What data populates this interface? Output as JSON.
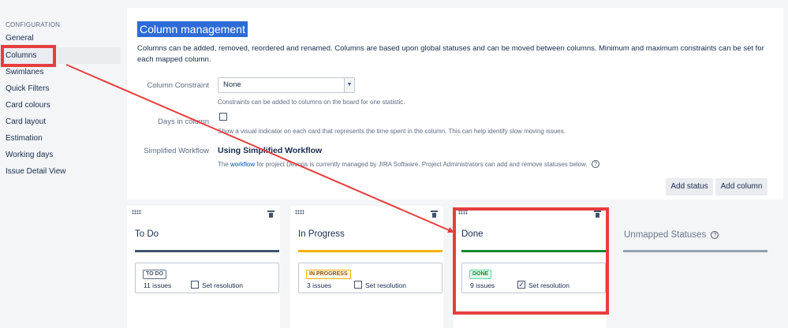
{
  "sidebar": {
    "heading": "CONFIGURATION",
    "items": [
      {
        "label": "General"
      },
      {
        "label": "Columns"
      },
      {
        "label": "Swimlanes"
      },
      {
        "label": "Quick Filters"
      },
      {
        "label": "Card colours"
      },
      {
        "label": "Card layout"
      },
      {
        "label": "Estimation"
      },
      {
        "label": "Working days"
      },
      {
        "label": "Issue Detail View"
      }
    ]
  },
  "main": {
    "title": "Column management",
    "description": "Columns can be added, removed, reordered and renamed. Columns are based upon global statuses and can be moved between columns. Minimum and maximum constraints can be set for each mapped column.",
    "column_constraint": {
      "label": "Column Constraint",
      "value": "None",
      "hint": "Constraints can be added to columns on the board for one statistic."
    },
    "days_in_column": {
      "label": "Days in column",
      "hint": "Show a visual indicator on each card that represents the time spent in the column. This can help identify slow moving issues."
    },
    "simplified_workflow": {
      "label": "Simplified Workflow",
      "title": "Using Simplified Workflow",
      "hint_prefix": "The ",
      "hint_link": "workflow",
      "hint_suffix": " for project Devops is currently managed by JIRA Software. Project Administrators can add and remove statuses below."
    },
    "add_status_label": "Add status",
    "add_column_label": "Add column"
  },
  "columns": [
    {
      "name": "To Do",
      "bar_color": "#42526e",
      "status": "TO DO",
      "status_color": "#42526e",
      "status_border": "#5e6c84",
      "status_bg": "#ffffff",
      "issues": "11 issues",
      "resolution_label": "Set resolution",
      "resolution_checked": false
    },
    {
      "name": "In Progress",
      "bar_color": "#f6b10d",
      "status": "IN PROGRESS",
      "status_color": "#974f0c",
      "status_border": "#f6b10d",
      "status_bg": "#fffae6",
      "issues": "3 issues",
      "resolution_label": "Set resolution",
      "resolution_checked": false
    },
    {
      "name": "Done",
      "bar_color": "#14892c",
      "status": "DONE",
      "status_color": "#14892c",
      "status_border": "#57d9a3",
      "status_bg": "#e3fcef",
      "issues": "9 issues",
      "resolution_label": "Set resolution",
      "resolution_checked": true
    }
  ],
  "unmapped": {
    "title": "Unmapped Statuses"
  },
  "annotation_color": "#e53e3e"
}
